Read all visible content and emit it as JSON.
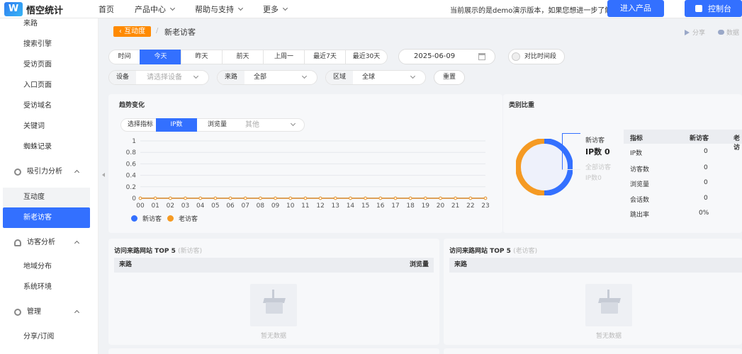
{
  "header": {
    "logo_mark": "W",
    "logo_text": "悟空统计",
    "nav": [
      {
        "label": "首页",
        "has_menu": false
      },
      {
        "label": "产品中心",
        "has_menu": true
      },
      {
        "label": "帮助与支持",
        "has_menu": true
      },
      {
        "label": "更多",
        "has_menu": true
      }
    ],
    "demo_note": "当前展示的是demo演示版本，如果您想进一步了解点击",
    "enter_product_label": "进入产品",
    "console_label": "控制台"
  },
  "sidebar": {
    "items_top": [
      "来路",
      "搜索引擎",
      "受访页面",
      "入口页面",
      "受访域名",
      "关键词",
      "蜘蛛记录"
    ],
    "group_attraction": "吸引力分析",
    "attraction_items": [
      "互动度",
      "新老访客"
    ],
    "active_item": "新老访客",
    "group_visitor": "访客分析",
    "visitor_items": [
      "地域分布",
      "系统环境"
    ],
    "group_manage": "管理",
    "manage_items": [
      "分享/订阅"
    ]
  },
  "breadcrumb": {
    "back_label": "互动度",
    "separator": "/",
    "title": "新老访客",
    "share_label": "分享",
    "data_label": "数据"
  },
  "time_filter": {
    "label": "时间",
    "options": [
      "今天",
      "昨天",
      "前天",
      "上周一",
      "最近7天",
      "最近30天"
    ],
    "active": "今天",
    "date": "2025-06-09",
    "compare_label": "对比时间段"
  },
  "filters": {
    "device_label": "设备",
    "device_placeholder": "请选择设备",
    "source_label": "来路",
    "source_value": "全部",
    "region_label": "区域",
    "region_value": "全球",
    "reset_label": "重置"
  },
  "trend": {
    "title": "趋势变化",
    "metric_label": "选择指标",
    "metric_active": "IP数",
    "metric_other": "浏览量",
    "metric_placeholder": "其他"
  },
  "chart_data": {
    "type": "line",
    "x": [
      "00",
      "01",
      "02",
      "03",
      "04",
      "05",
      "06",
      "07",
      "08",
      "09",
      "10",
      "11",
      "12",
      "13",
      "14",
      "15",
      "16",
      "17",
      "18",
      "19",
      "20",
      "21",
      "22",
      "23"
    ],
    "y_ticks": [
      "0",
      "0.2",
      "0.4",
      "0.6",
      "0.8",
      "1"
    ],
    "ylim": [
      0,
      1
    ],
    "series": [
      {
        "name": "新访客",
        "color": "#3370ff",
        "values": [
          0,
          0,
          0,
          0,
          0,
          0,
          0,
          0,
          0,
          0,
          0,
          0,
          0,
          0,
          0,
          0,
          0,
          0,
          0,
          0,
          0,
          0,
          0,
          0
        ]
      },
      {
        "name": "老访客",
        "color": "#f59a23",
        "values": [
          0,
          0,
          0,
          0,
          0,
          0,
          0,
          0,
          0,
          0,
          0,
          0,
          0,
          0,
          0,
          0,
          0,
          0,
          0,
          0,
          0,
          0,
          0,
          0
        ]
      }
    ],
    "legend_position": "bottom-left",
    "grid": true
  },
  "ratio": {
    "title": "类别比重",
    "donut_colors": [
      "#3370ff",
      "#f59a23"
    ],
    "new_label": "新访客",
    "new_value": "IP数 0",
    "all_label": "全部访客",
    "all_value": "IP数0",
    "table": {
      "headers": [
        "指标",
        "新访客",
        "老访"
      ],
      "rows": [
        [
          "IP数",
          "0"
        ],
        [
          "访客数",
          "0"
        ],
        [
          "浏览量",
          "0"
        ],
        [
          "会话数",
          "0"
        ],
        [
          "跳出率",
          "0%"
        ]
      ]
    }
  },
  "top_new": {
    "title": "访问来路网站 TOP 5",
    "subtitle": "(新访客)",
    "col_source": "来路",
    "col_pv": "浏览量",
    "empty_text": "暂无数据"
  },
  "top_old": {
    "title": "访问来路网站 TOP 5",
    "subtitle": "(老访客)",
    "col_source": "来路",
    "empty_text": "暂无数据"
  }
}
